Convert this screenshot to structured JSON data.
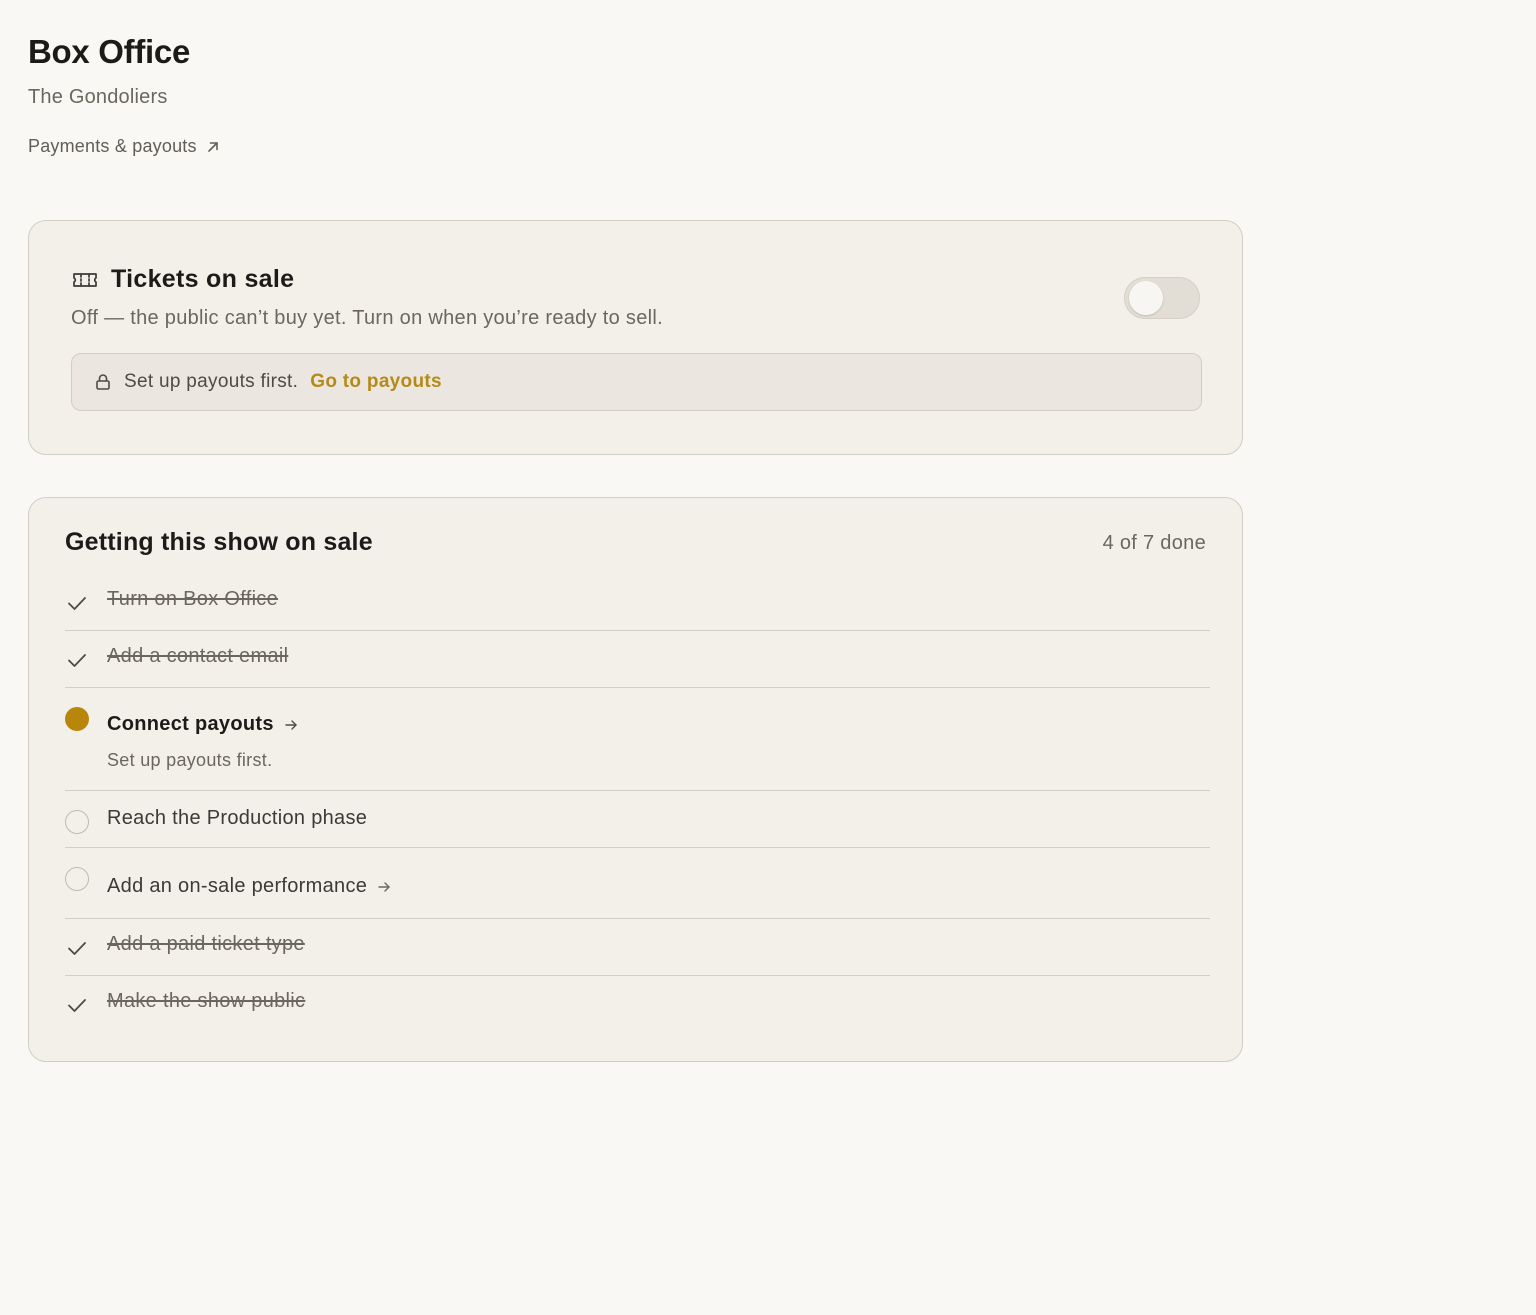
{
  "header": {
    "title": "Box Office",
    "subtitle": "The Gondoliers",
    "payments_link": "Payments & payouts"
  },
  "sale_card": {
    "title": "Tickets on sale",
    "description": "Off — the public can’t buy yet. Turn on when you’re ready to sell.",
    "toggle_on": false,
    "notice_text": "Set up payouts first.",
    "notice_link": "Go to payouts"
  },
  "checklist": {
    "title": "Getting this show on sale",
    "progress": "4 of 7 done",
    "items": [
      {
        "label": "Turn on Box Office",
        "status": "done"
      },
      {
        "label": "Add a contact email",
        "status": "done"
      },
      {
        "label": "Connect payouts",
        "status": "current",
        "detail": "Set up payouts first."
      },
      {
        "label": "Reach the Production phase",
        "status": "pending"
      },
      {
        "label": "Add an on-sale performance",
        "status": "pending"
      },
      {
        "label": "Add a paid ticket type",
        "status": "done"
      },
      {
        "label": "Make the show public",
        "status": "done"
      }
    ]
  },
  "colors": {
    "background": "#f9f8f5",
    "card": "#f3f0ea",
    "accent": "#b8860b",
    "link": "#b58a16"
  }
}
